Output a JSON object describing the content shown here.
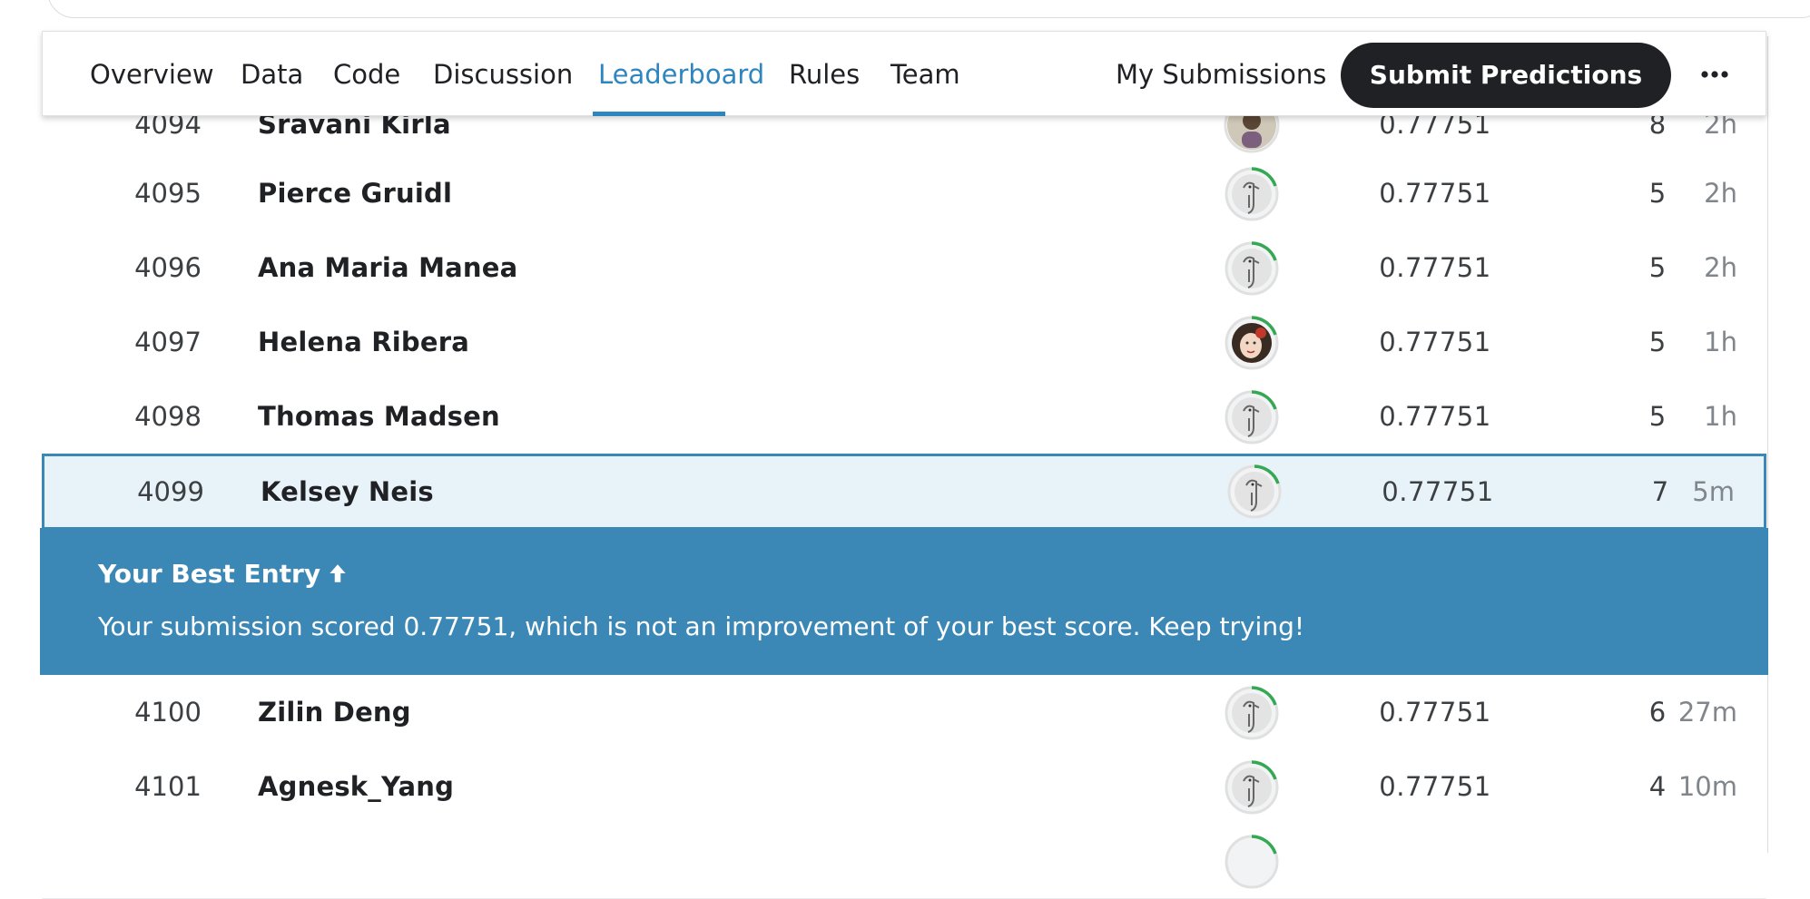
{
  "nav": {
    "tabs": [
      "Overview",
      "Data",
      "Code",
      "Discussion",
      "Leaderboard",
      "Rules",
      "Team"
    ],
    "active_tab": "Leaderboard",
    "my_submissions": "My Submissions",
    "submit_button": "Submit Predictions"
  },
  "leaderboard": {
    "rows_before": [
      {
        "rank": "4094",
        "name": "Sravani Kirla",
        "score": "0.77751",
        "entries": "8",
        "last": "2h",
        "avatar": "photo"
      },
      {
        "rank": "4095",
        "name": "Pierce Gruidl",
        "score": "0.77751",
        "entries": "5",
        "last": "2h",
        "avatar": "goose"
      },
      {
        "rank": "4096",
        "name": "Ana Maria Manea",
        "score": "0.77751",
        "entries": "5",
        "last": "2h",
        "avatar": "goose"
      },
      {
        "rank": "4097",
        "name": "Helena Ribera",
        "score": "0.77751",
        "entries": "5",
        "last": "1h",
        "avatar": "photo"
      },
      {
        "rank": "4098",
        "name": "Thomas Madsen",
        "score": "0.77751",
        "entries": "5",
        "last": "1h",
        "avatar": "goose"
      }
    ],
    "highlighted_row": {
      "rank": "4099",
      "name": "Kelsey Neis",
      "score": "0.77751",
      "entries": "7",
      "last": "5m",
      "avatar": "goose"
    },
    "rows_after": [
      {
        "rank": "4100",
        "name": "Zilin Deng",
        "score": "0.77751",
        "entries": "6",
        "last": "27m",
        "avatar": "goose"
      },
      {
        "rank": "4101",
        "name": "Agnesk_Yang",
        "score": "0.77751",
        "entries": "4",
        "last": "10m",
        "avatar": "goose"
      }
    ]
  },
  "best_entry": {
    "title": "Your Best Entry",
    "message": "Your submission scored 0.77751, which is not an improvement of your best score. Keep trying!"
  },
  "colors": {
    "accent": "#2e86c1",
    "banner": "#3b88b7",
    "highlight_bg": "#e8f3f9",
    "tier_ring": "#34a853"
  }
}
